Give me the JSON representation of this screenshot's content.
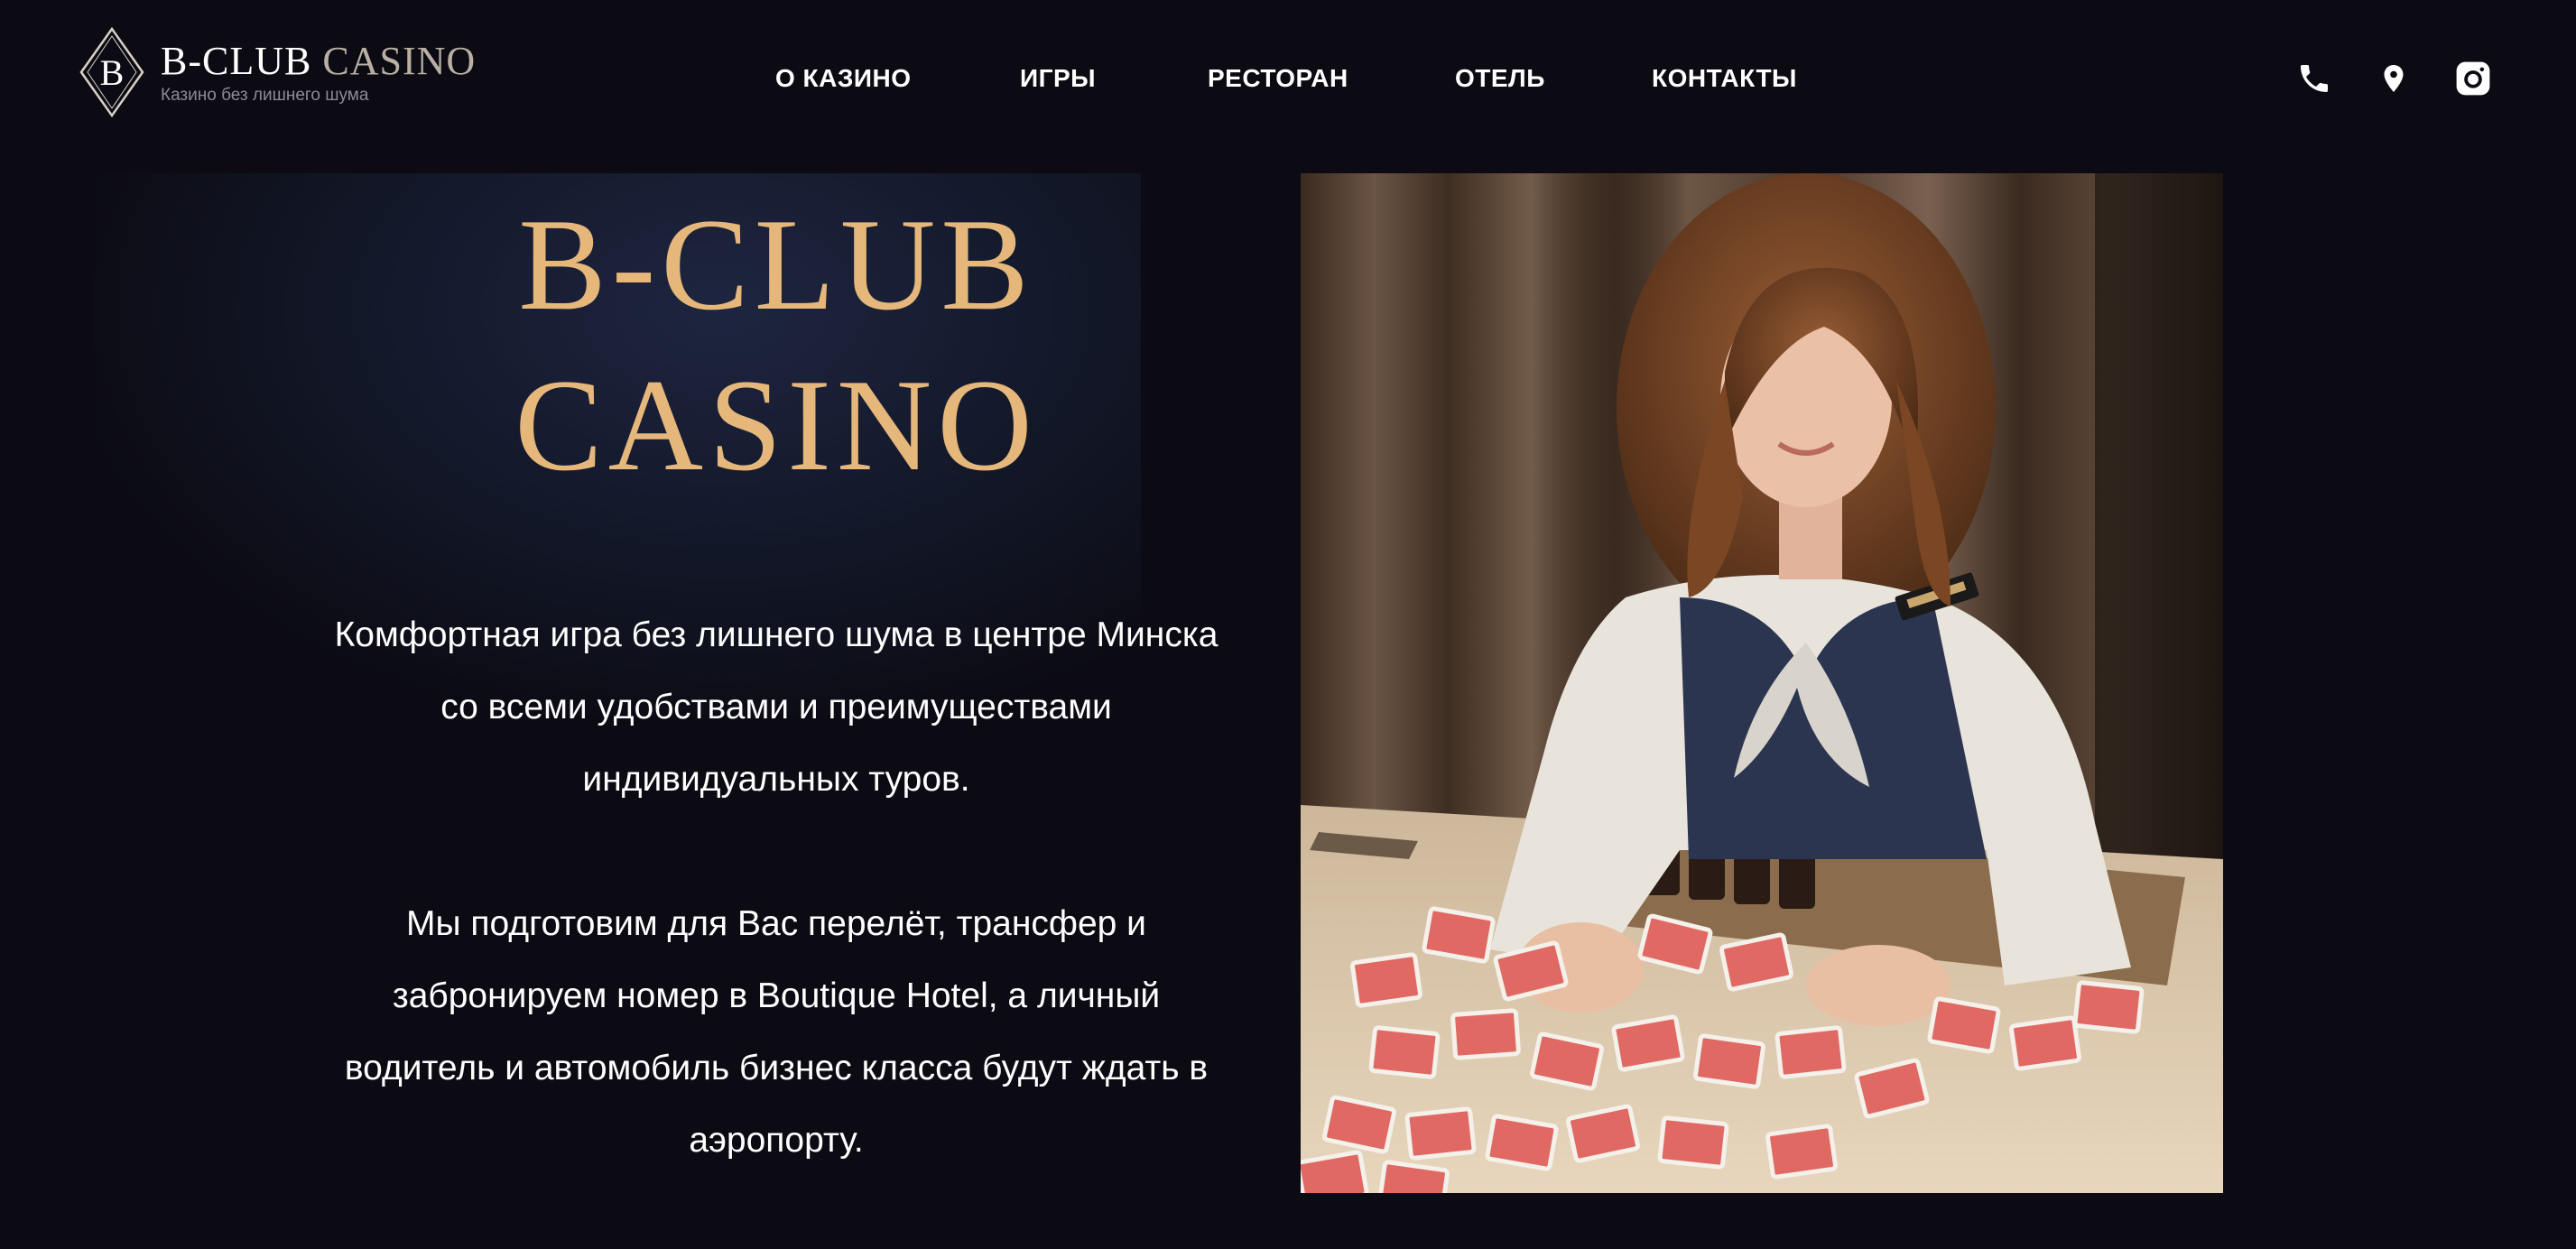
{
  "header": {
    "logo": {
      "title_primary": "B-CLUB",
      "title_secondary": "CASINO",
      "subtitle": "Казино без лишнего шума",
      "mark_letter": "B"
    },
    "nav": [
      {
        "label": "О КАЗИНО"
      },
      {
        "label": "ИГРЫ"
      },
      {
        "label": "РЕСТОРАН"
      },
      {
        "label": "ОТЕЛЬ"
      },
      {
        "label": "КОНТАКТЫ"
      }
    ],
    "icons": [
      "phone-icon",
      "location-icon",
      "instagram-icon"
    ]
  },
  "hero": {
    "title_line1": "B-CLUB",
    "title_line2": "CASINO",
    "paragraph1": "Комфортная игра без лишнего шума в центре Минска со всеми удобствами и преимуществами индивидуальных туров.",
    "paragraph2": "Мы подготовим для Вас перелёт, трансфер и забронируем номер в Boutique Hotel, а личный водитель и автомобиль бизнес класса будут ждать в аэропорту."
  },
  "colors": {
    "background": "#0c0b14",
    "accent_gold": "#e6b77a",
    "text": "#ffffff",
    "logo_secondary": "#b9b0a3"
  }
}
